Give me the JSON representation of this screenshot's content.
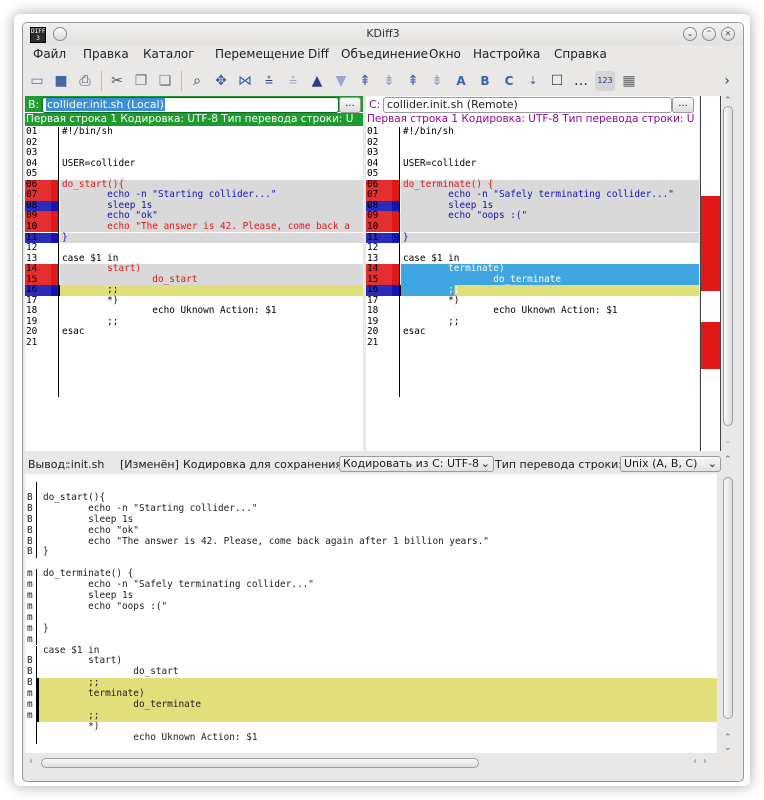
{
  "window": {
    "title": "KDiff3"
  },
  "menu": [
    "Файл",
    "Правка",
    "Каталог",
    "Перемещение",
    "Diff",
    "Объединение",
    "Окно",
    "Настройка",
    "Справка"
  ],
  "toolbar": {
    "labels": [
      "A",
      "B",
      "C",
      "123"
    ],
    "chevron": "›"
  },
  "pane_b": {
    "prefix": "B:",
    "file": "collider.init.sh (Local)",
    "browse": "...",
    "info": "Первая строка 1  Кодировка: UTF-8 Тип перевода строки: U",
    "lines": [
      {
        "n": "01",
        "t": "#!/bin/sh",
        "m": ""
      },
      {
        "n": "02",
        "t": "",
        "m": ""
      },
      {
        "n": "03",
        "t": "",
        "m": ""
      },
      {
        "n": "04",
        "t": "USER=collider",
        "m": ""
      },
      {
        "n": "05",
        "t": "",
        "m": ""
      },
      {
        "n": "06",
        "t": "do_start(){",
        "m": "red",
        "c": "red",
        "bg": "grey"
      },
      {
        "n": "07",
        "t": "        echo -n \"Starting collider...\"",
        "m": "red",
        "c": "blue",
        "bg": "grey"
      },
      {
        "n": "08",
        "t": "        sleep 1s",
        "m": "blue",
        "c": "blue",
        "bg": "grey"
      },
      {
        "n": "09",
        "t": "        echo \"ok\"",
        "m": "red",
        "c": "blue",
        "bg": "grey"
      },
      {
        "n": "10",
        "t": "        echo \"The answer is 42. Please, come back a",
        "m": "red",
        "c": "red",
        "bg": "grey"
      },
      {
        "n": "11",
        "t": "}",
        "m": "blue",
        "c": "blue",
        "bg": "grey"
      },
      {
        "n": "12",
        "t": "",
        "m": ""
      },
      {
        "n": "13",
        "t": "case $1 in",
        "m": ""
      },
      {
        "n": "14",
        "t": "        start)",
        "m": "red",
        "c": "red",
        "bg": "grey"
      },
      {
        "n": "15",
        "t": "                do_start",
        "m": "red",
        "c": "red",
        "bg": "grey"
      },
      {
        "n": "16",
        "t": "        ;;",
        "m": "blue",
        "c": "",
        "bg": "yellow"
      },
      {
        "n": "17",
        "t": "        *)",
        "m": ""
      },
      {
        "n": "18",
        "t": "                echo Uknown Action: $1",
        "m": ""
      },
      {
        "n": "19",
        "t": "        ;;",
        "m": ""
      },
      {
        "n": "20",
        "t": "esac",
        "m": ""
      },
      {
        "n": "21",
        "t": "",
        "m": ""
      }
    ]
  },
  "pane_c": {
    "prefix": "C:",
    "file": "collider.init.sh (Remote)",
    "browse": "...",
    "info": "Первая строка 1  Кодировка: UTF-8 Тип перевода строки: U",
    "lines": [
      {
        "n": "01",
        "t": "#!/bin/sh",
        "m": ""
      },
      {
        "n": "02",
        "t": "",
        "m": ""
      },
      {
        "n": "03",
        "t": "",
        "m": ""
      },
      {
        "n": "04",
        "t": "USER=collider",
        "m": ""
      },
      {
        "n": "05",
        "t": "",
        "m": ""
      },
      {
        "n": "06",
        "t": "do_terminate() {",
        "m": "red",
        "c": "red",
        "bg": "grey"
      },
      {
        "n": "07",
        "t": "        echo -n \"Safely terminating collider...\"",
        "m": "red",
        "c": "blue",
        "bg": "grey"
      },
      {
        "n": "08",
        "t": "        sleep 1s",
        "m": "blue",
        "c": "blue",
        "bg": "grey"
      },
      {
        "n": "09",
        "t": "        echo \"oops :(\"",
        "m": "red",
        "c": "blue",
        "bg": "grey"
      },
      {
        "n": "10",
        "t": "",
        "m": "red",
        "c": "",
        "bg": "grey"
      },
      {
        "n": "11",
        "t": "}",
        "m": "blue",
        "c": "blue",
        "bg": "grey"
      },
      {
        "n": "12",
        "t": "",
        "m": ""
      },
      {
        "n": "13",
        "t": "case $1 in",
        "m": ""
      },
      {
        "n": "14",
        "t": "        terminate)",
        "m": "red",
        "c": "white",
        "bg": "sel"
      },
      {
        "n": "15",
        "t": "                do_terminate",
        "m": "red",
        "c": "white",
        "bg": "sel"
      },
      {
        "n": "16",
        "t": "        ;;",
        "m": "blue",
        "c": "white",
        "bg": "selyellow"
      },
      {
        "n": "17",
        "t": "        *)",
        "m": ""
      },
      {
        "n": "18",
        "t": "                echo Uknown Action: $1",
        "m": ""
      },
      {
        "n": "19",
        "t": "        ;;",
        "m": ""
      },
      {
        "n": "20",
        "t": "esac",
        "m": ""
      },
      {
        "n": "21",
        "t": "",
        "m": ""
      }
    ]
  },
  "output": {
    "label": "Вывод:",
    "file": ":init.sh",
    "state": "[Изменён]",
    "enc_label": "Кодировка для сохранения:",
    "enc_value": "Кодировать из C: UTF-8",
    "eol_label": "Тип перевода строки:",
    "eol_value": "Unix (A, B, C)",
    "lines": [
      {
        "s": "",
        "t": ""
      },
      {
        "s": "B",
        "t": "do_start(){"
      },
      {
        "s": "B",
        "t": "        echo -n \"Starting collider...\""
      },
      {
        "s": "B",
        "t": "        sleep 1s"
      },
      {
        "s": "B",
        "t": "        echo \"ok\""
      },
      {
        "s": "B",
        "t": "        echo \"The answer is 42. Please, come back again after 1 billion years.\""
      },
      {
        "s": "B",
        "t": "}"
      },
      {
        "s": "",
        "t": ""
      },
      {
        "s": "m",
        "t": "do_terminate() {"
      },
      {
        "s": "m",
        "t": "        echo -n \"Safely terminating collider...\""
      },
      {
        "s": "m",
        "t": "        sleep 1s"
      },
      {
        "s": "m",
        "t": "        echo \"oops :(\""
      },
      {
        "s": "m",
        "t": ""
      },
      {
        "s": "m",
        "t": "}"
      },
      {
        "s": "m",
        "t": ""
      },
      {
        "s": "",
        "t": "case $1 in"
      },
      {
        "s": "B",
        "t": "        start)"
      },
      {
        "s": "B",
        "t": "                do_start"
      },
      {
        "s": "B",
        "t": "        ;;",
        "hl": true
      },
      {
        "s": "m",
        "t": "        terminate)",
        "hl": true
      },
      {
        "s": "m",
        "t": "                do_terminate",
        "hl": true
      },
      {
        "s": "m",
        "t": "        ;;",
        "hl": true
      },
      {
        "s": "",
        "t": "        *)"
      },
      {
        "s": "",
        "t": "                echo Uknown Action: $1"
      }
    ]
  },
  "colors": {
    "red": "#e01818",
    "blue": "#1414b4",
    "grey": "#d9d9d9",
    "yellow": "#e0df7a",
    "sel": "#3ea5e0",
    "accent_green": "#1e9b2e",
    "magenta": "#8e0a8e"
  }
}
